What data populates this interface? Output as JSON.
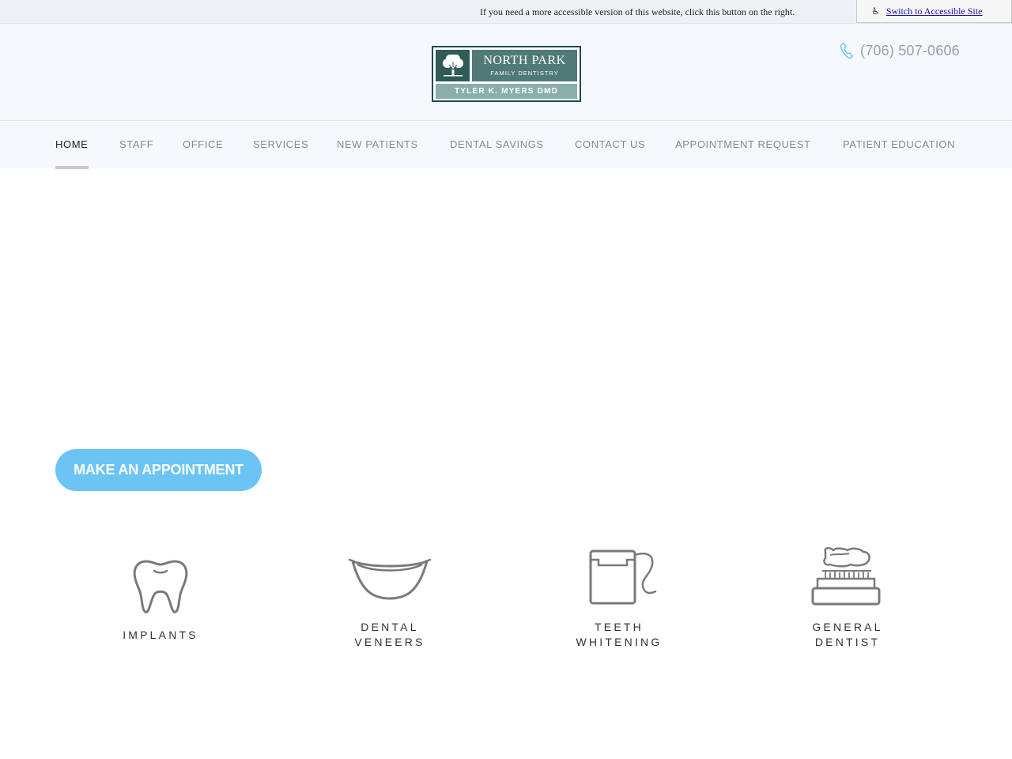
{
  "accessibility_bar": {
    "message": "If you need a more accessible version of this website, click this button on the right.",
    "button_label": "Switch to Accessible Site",
    "button_icon": "wheelchair-icon"
  },
  "header": {
    "logo": {
      "line1": "NORTH PARK",
      "line2": "FAMILY DENTISTRY",
      "line3": "TYLER K. MYERS DMD",
      "icon": "tree-icon"
    },
    "phone": "(706) 507-0606",
    "phone_icon": "phone-icon"
  },
  "nav": {
    "items": [
      {
        "label": "HOME",
        "active": true
      },
      {
        "label": "STAFF"
      },
      {
        "label": "OFFICE"
      },
      {
        "label": "SERVICES"
      },
      {
        "label": "NEW PATIENTS"
      },
      {
        "label": "DENTAL SAVINGS"
      },
      {
        "label": "CONTACT US"
      },
      {
        "label": "APPOINTMENT REQUEST"
      },
      {
        "label": "PATIENT EDUCATION"
      }
    ]
  },
  "cta": {
    "label": "MAKE AN APPOINTMENT"
  },
  "services": [
    {
      "line1": "IMPLANTS",
      "line2": "",
      "icon": "tooth-icon"
    },
    {
      "line1": "DENTAL",
      "line2": "VENEERS",
      "icon": "smile-icon"
    },
    {
      "line1": "TEETH",
      "line2": "WHITENING",
      "icon": "floss-icon"
    },
    {
      "line1": "GENERAL",
      "line2": "DENTIST",
      "icon": "toothbrush-icon"
    }
  ],
  "colors": {
    "accent": "#6cc4f4",
    "logo_dark": "#2f5b58",
    "logo_mid": "#4f7a78",
    "logo_light": "#8aaeac",
    "header_bg": "#f5f9fd"
  }
}
